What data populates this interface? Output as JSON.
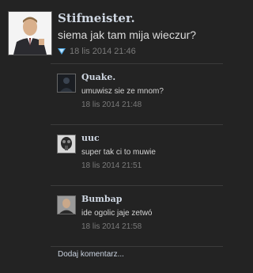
{
  "post": {
    "author": "Stifmeister.",
    "text": "siema jak tam mija wieczur?",
    "timestamp": "18 lis 2014 21:46",
    "avatar_icon": "man-in-suit-avatar",
    "meta_icon": "like-icon"
  },
  "comments": [
    {
      "author": "Quake.",
      "text": "umuwisz sie ze mnom?",
      "timestamp": "18 lis 2014 21:48",
      "avatar_icon": "dark-avatar"
    },
    {
      "author": "uuc",
      "text": "super tak ci to muwie",
      "timestamp": "18 lis 2014 21:51",
      "avatar_icon": "gasmask-avatar"
    },
    {
      "author": "Bumbap",
      "text": "ide ogolic jaje zetwó",
      "timestamp": "18 lis 2014 21:58",
      "avatar_icon": "bald-man-avatar"
    }
  ],
  "add_comment_label": "Dodaj komentarz..."
}
